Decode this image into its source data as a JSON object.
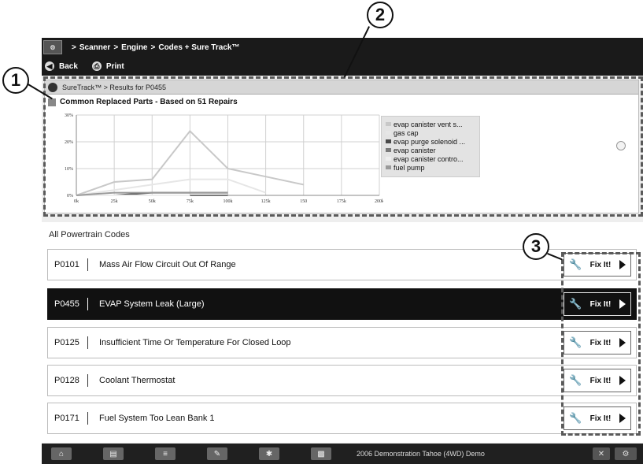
{
  "callouts": [
    "1",
    "2",
    "3"
  ],
  "breadcrumb": {
    "logo": "⚙",
    "items": [
      "Scanner",
      "Engine",
      "Codes + Sure Track™"
    ],
    "separator": ">"
  },
  "toolbar": {
    "back_label": "Back",
    "print_label": "Print"
  },
  "suretrack": {
    "header": "SureTrack™  > Results for P0455",
    "chart_title": "Common Replaced Parts - Based on 51 Repairs"
  },
  "chart_data": {
    "type": "line",
    "title": "Common Replaced Parts - Based on 51 Repairs",
    "x_ticks": [
      "0k",
      "25k",
      "50k",
      "75k",
      "100k",
      "125k",
      "150",
      "175k",
      "200k"
    ],
    "y_ticks": [
      "0%",
      "10%",
      "20%",
      "30%"
    ],
    "x": [
      0,
      25,
      50,
      75,
      100,
      125,
      150
    ],
    "ylim": [
      0,
      30
    ],
    "xlim": [
      0,
      200
    ],
    "grid": true,
    "legend_position": "right",
    "series": [
      {
        "name": "evap canister vent s...",
        "color": "#c8c8c8",
        "values": [
          0,
          5,
          6,
          24,
          10,
          7,
          4
        ]
      },
      {
        "name": "gas cap",
        "color": "#e6e6e6",
        "values": [
          0,
          2,
          4,
          6,
          6,
          1,
          null
        ]
      },
      {
        "name": "evap purge solenoid ...",
        "color": "#4a4a4a",
        "values": [
          0,
          0,
          1,
          1,
          1,
          null,
          null
        ]
      },
      {
        "name": "evap canister",
        "color": "#7a7a7a",
        "values": [
          0,
          0,
          0,
          0,
          0,
          null,
          null
        ]
      },
      {
        "name": "evap canister contro...",
        "color": "#eeeeee",
        "values": [
          0,
          0,
          0,
          0,
          null,
          null,
          null
        ]
      },
      {
        "name": "fuel pump",
        "color": "#9a9a9a",
        "values": [
          0,
          1,
          1,
          1,
          1,
          null,
          null
        ]
      }
    ]
  },
  "codes": {
    "section_title": "All Powertrain Codes",
    "fix_label": "Fix It!",
    "rows": [
      {
        "code": "P0101",
        "description": "Mass Air Flow Circuit Out Of Range"
      },
      {
        "code": "P0455",
        "description": "EVAP System Leak (Large)"
      },
      {
        "code": "P0125",
        "description": "Insufficient Time Or Temperature For Closed Loop"
      },
      {
        "code": "P0128",
        "description": "Coolant Thermostat"
      },
      {
        "code": "P0171",
        "description": "Fuel System Too Lean Bank 1"
      }
    ]
  },
  "bottom_bar": {
    "vehicle": "2006 Demonstration Tahoe (4WD) Demo",
    "icons": [
      "home-icon",
      "toolbox-icon",
      "list-icon",
      "edit-icon",
      "settings-icon",
      "vehicle-icon"
    ],
    "right_icons": [
      "close-icon",
      "gear-icon"
    ]
  }
}
